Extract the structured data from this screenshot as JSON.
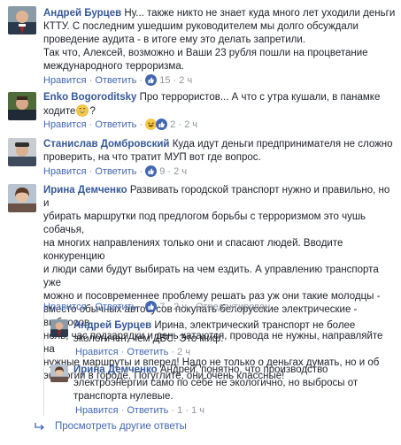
{
  "comments": [
    {
      "author": "Андрей Бурцев",
      "lines": [
        "Ну... также никто не знает куда много лет уходили деньги",
        "КТТУ. С последним ушедшим руководителем мы долго обсуждали",
        "проведение аудита - в итоге ему это делать запретили.",
        "Так что, Алексей, возможно и Ваши 23 рубля пошли на процветание",
        "международного терроризма."
      ],
      "like": "Нравится",
      "reply": "Ответить",
      "reactions": [
        "like-reaction-icon"
      ],
      "count": "15",
      "time": "2 ч"
    },
    {
      "author": "Enko Bogoroditsky",
      "lines": [
        "Про террористов... А что с утра кушали, в панамке",
        "ходите",
        "?"
      ],
      "emoji": "grin-emoji-icon",
      "like": "Нравится",
      "reply": "Ответить",
      "reactions": [
        "laugh-reaction-icon",
        "like-reaction-icon"
      ],
      "count": "2",
      "time": "2 ч"
    },
    {
      "author": "Станислав Домбровский",
      "lines": [
        "Куда идут деньги предпринимателя не сложно",
        "проверить, на что тратит МУП вот где вопрос."
      ],
      "like": "Нравится",
      "reply": "Ответить",
      "reactions": [
        "like-reaction-icon"
      ],
      "count": "9",
      "time": "2 ч"
    },
    {
      "author": "Ирина Демченко",
      "lines": [
        "Развивать городской транспорт нужно и правильно, но и",
        "убирать маршрутки под предлогом борьбы с терроризмом это чушь собачья,",
        "на многих направлениях только они и спасают людей. Вводите конкуренцию",
        "и люди сами будут выбирать на чем ездить. А управлению транспорта уже",
        "можно и посовременнее проблему решать раз уж они такие молодцы -",
        "вместо обычных автобусов покупать белорусские электрические - выбросов",
        "ноль, час подзарядки и день катаются, провода не нужны, направляйте на",
        "нужные маршруты и вперед! Надо не только о деньгах думать, но и об",
        "экологии в городе. Погуглите, они очень классные!"
      ],
      "like": "Нравится",
      "reply": "Ответить",
      "reactions": [
        "like-reaction-icon"
      ],
      "count": "7",
      "time": "2 ч",
      "edited": "Отредактирован"
    }
  ],
  "replies": [
    {
      "author": "Андрей Бурцев",
      "lines": [
        "Ирина, электрический транспорт не более",
        "экологичен, чем ДВС. Это миф."
      ],
      "like": "Нравится",
      "reply": "Ответить",
      "time": "2 ч"
    },
    {
      "author": "Ирина Демченко",
      "lines": [
        "Андрей, понятно, что производство",
        "электроэнергии само по себе не экологично, но выбросы от",
        "транспорта нулевые."
      ],
      "like": "Нравится",
      "reply": "Ответить",
      "count": "1",
      "time": "1 ч"
    }
  ],
  "more_link": "Просмотреть другие ответы",
  "more_icon": "reply-arrow-icon",
  "colors": {
    "link": "#365899",
    "action": "#4267b2",
    "meta": "#90949c"
  }
}
